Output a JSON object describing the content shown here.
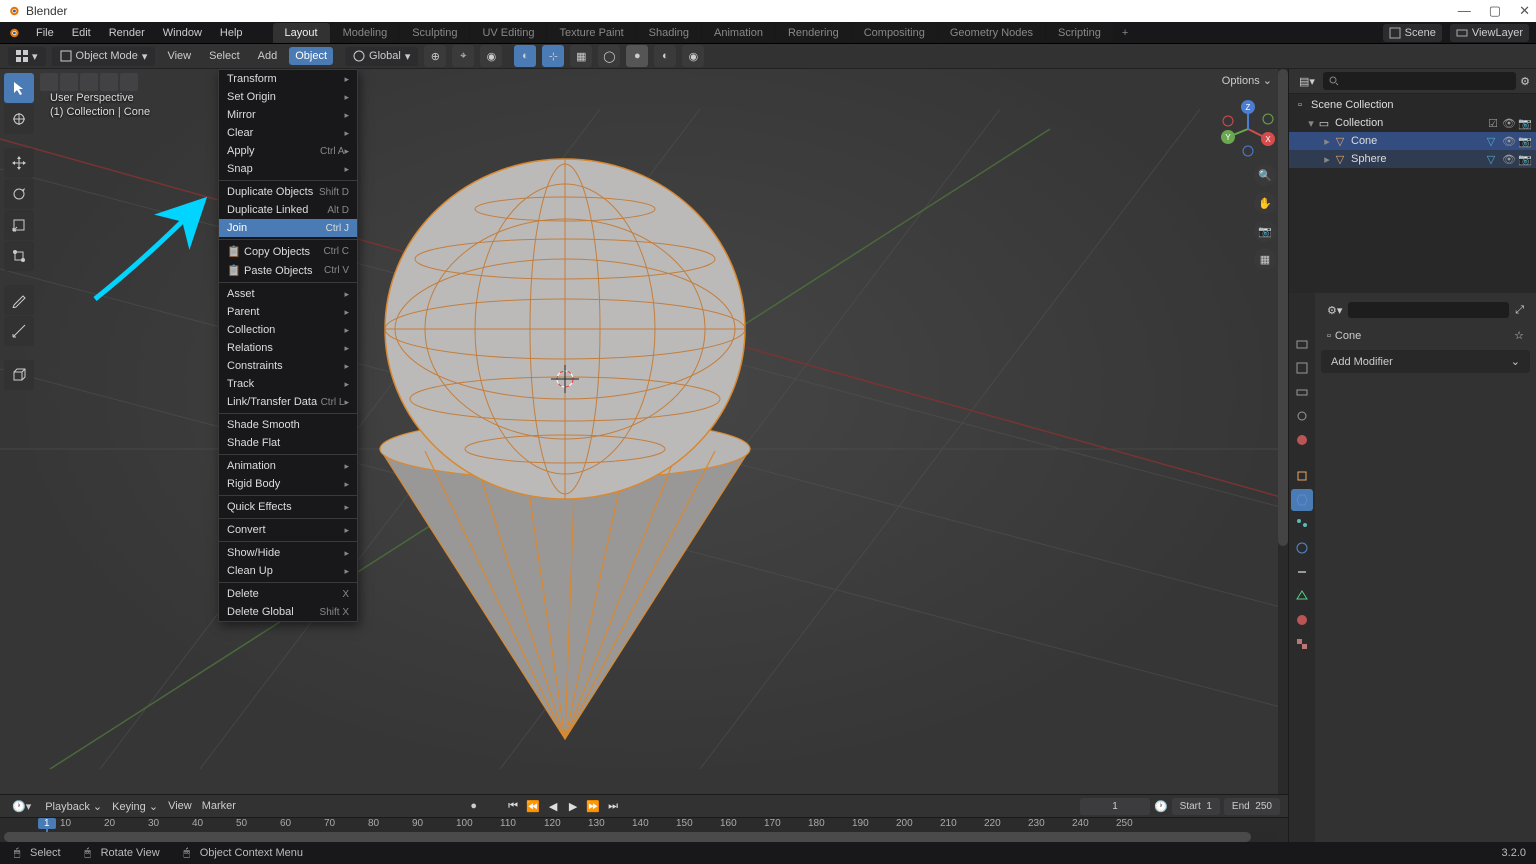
{
  "window_title": "Blender",
  "top_menu": [
    "File",
    "Edit",
    "Render",
    "Window",
    "Help"
  ],
  "workspace_tabs": [
    "Layout",
    "Modeling",
    "Sculpting",
    "UV Editing",
    "Texture Paint",
    "Shading",
    "Animation",
    "Rendering",
    "Compositing",
    "Geometry Nodes",
    "Scripting"
  ],
  "active_tab": "Layout",
  "scene_label": "Scene",
  "viewlayer_label": "ViewLayer",
  "mode_label": "Object Mode",
  "header_menu": [
    "View",
    "Select",
    "Add",
    "Object"
  ],
  "active_header_menu": "Object",
  "orientation_label": "Global",
  "options_label": "Options",
  "perspective": {
    "line1": "User Perspective",
    "line2": "(1) Collection | Cone"
  },
  "context_menu": {
    "groups": [
      [
        {
          "label": "Transform",
          "arrow": true
        },
        {
          "label": "Set Origin",
          "arrow": true
        },
        {
          "label": "Mirror",
          "arrow": true
        },
        {
          "label": "Clear",
          "arrow": true
        },
        {
          "label": "Apply",
          "shortcut": "Ctrl A",
          "arrow": true
        },
        {
          "label": "Snap",
          "arrow": true
        }
      ],
      [
        {
          "label": "Duplicate Objects",
          "shortcut": "Shift D"
        },
        {
          "label": "Duplicate Linked",
          "shortcut": "Alt D"
        },
        {
          "label": "Join",
          "shortcut": "Ctrl J",
          "highlight": true
        }
      ],
      [
        {
          "label": "Copy Objects",
          "shortcut": "Ctrl C",
          "icon": true
        },
        {
          "label": "Paste Objects",
          "shortcut": "Ctrl V",
          "icon": true
        }
      ],
      [
        {
          "label": "Asset",
          "arrow": true
        },
        {
          "label": "Parent",
          "arrow": true
        },
        {
          "label": "Collection",
          "arrow": true
        },
        {
          "label": "Relations",
          "arrow": true
        },
        {
          "label": "Constraints",
          "arrow": true
        },
        {
          "label": "Track",
          "arrow": true
        },
        {
          "label": "Link/Transfer Data",
          "shortcut": "Ctrl L",
          "arrow": true
        }
      ],
      [
        {
          "label": "Shade Smooth"
        },
        {
          "label": "Shade Flat"
        }
      ],
      [
        {
          "label": "Animation",
          "arrow": true
        },
        {
          "label": "Rigid Body",
          "arrow": true
        }
      ],
      [
        {
          "label": "Quick Effects",
          "arrow": true
        }
      ],
      [
        {
          "label": "Convert",
          "arrow": true
        }
      ],
      [
        {
          "label": "Show/Hide",
          "arrow": true
        },
        {
          "label": "Clean Up",
          "arrow": true
        }
      ],
      [
        {
          "label": "Delete",
          "shortcut": "X"
        },
        {
          "label": "Delete Global",
          "shortcut": "Shift X"
        }
      ]
    ]
  },
  "outliner": {
    "root": "Scene Collection",
    "collection": "Collection",
    "items": [
      {
        "name": "Cone",
        "selected": true
      },
      {
        "name": "Sphere",
        "selected": false
      }
    ]
  },
  "properties": {
    "crumb": "Cone",
    "add_modifier": "Add Modifier"
  },
  "timeline": {
    "menus": [
      "Playback",
      "Keying",
      "View",
      "Marker"
    ],
    "ticks": [
      "10",
      "20",
      "30",
      "40",
      "50",
      "60",
      "70",
      "80",
      "90",
      "100",
      "110",
      "120",
      "130",
      "140",
      "150",
      "160",
      "170",
      "180",
      "190",
      "200",
      "210",
      "220",
      "230",
      "240",
      "250"
    ],
    "current": "1",
    "start_label": "Start",
    "start": "1",
    "end_label": "End",
    "end": "250",
    "frame": "1"
  },
  "statusbar": {
    "select": "Select",
    "rotate": "Rotate View",
    "context": "Object Context Menu",
    "version": "3.2.0"
  }
}
